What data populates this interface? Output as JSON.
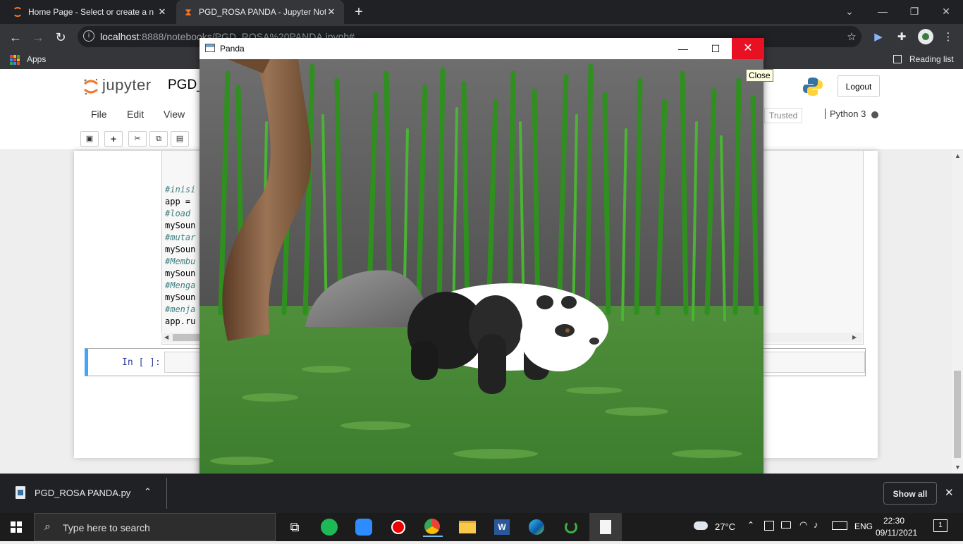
{
  "browser": {
    "tabs": [
      {
        "title": "Home Page - Select or create a n",
        "active": false
      },
      {
        "title": "PGD_ROSA PANDA - Jupyter Not",
        "active": true
      }
    ],
    "url_host": "localhost",
    "url_rest": ":8888/notebooks/PGD_ROSA%20PANDA.ipynb#",
    "bookmarks_apps": "Apps",
    "reading_list": "Reading list"
  },
  "jupyter": {
    "logo_text": "jupyter",
    "notebook_name": "PGD_",
    "logout": "Logout",
    "menus": [
      "File",
      "Edit",
      "View"
    ],
    "trusted": "Trusted",
    "kernel": "Python 3",
    "code_lines": [
      {
        "text": "#inisi",
        "comment": true
      },
      {
        "text": "app = ",
        "comment": false
      },
      {
        "text": "#load ",
        "comment": true
      },
      {
        "text": "mySoun",
        "comment": false
      },
      {
        "text": "#mutar",
        "comment": true
      },
      {
        "text": "mySoun",
        "comment": false
      },
      {
        "text": "#Membu",
        "comment": true
      },
      {
        "text": "mySoun",
        "comment": false
      },
      {
        "text": "#Menga",
        "comment": true
      },
      {
        "text": "mySoun",
        "comment": false
      },
      {
        "text": "#menja",
        "comment": true
      },
      {
        "text": "app.ru",
        "comment": false
      }
    ],
    "prompt": "In [ ]:"
  },
  "panda_window": {
    "title": "Panda",
    "tooltip": "Close"
  },
  "download_bar": {
    "filename": "PGD_ROSA PANDA.py",
    "show_all": "Show all"
  },
  "taskbar": {
    "search_placeholder": "Type here to search",
    "temperature": "27°C",
    "language": "ENG",
    "time": "22:30",
    "date": "09/11/2021",
    "notifications": "1"
  }
}
